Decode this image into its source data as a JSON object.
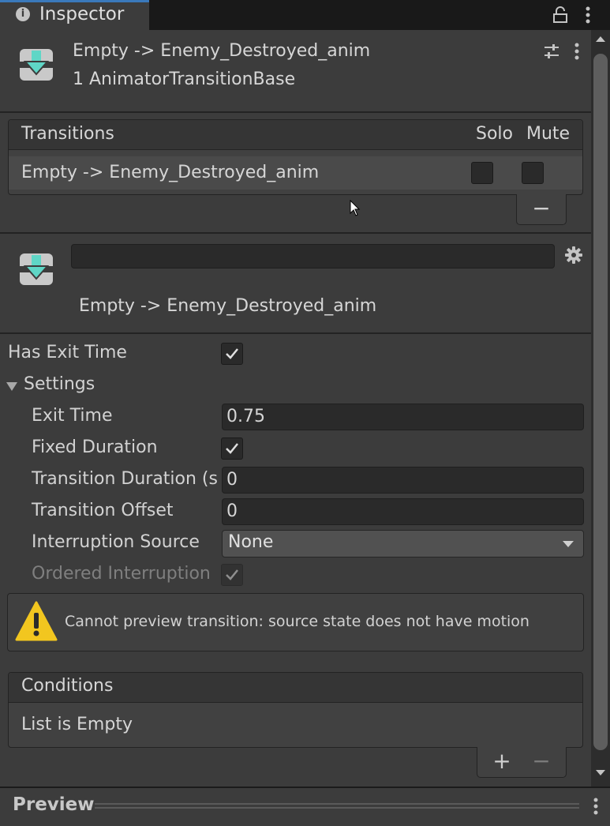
{
  "tab": {
    "title": "Inspector",
    "icon": "info-icon"
  },
  "header": {
    "title": "Empty -> Enemy_Destroyed_anim",
    "subtitle": "1 AnimatorTransitionBase"
  },
  "transitions": {
    "title": "Transitions",
    "solo_label": "Solo",
    "mute_label": "Mute",
    "rows": [
      {
        "label": "Empty -> Enemy_Destroyed_anim",
        "solo": false,
        "mute": false
      }
    ],
    "remove_label": "−"
  },
  "transition": {
    "name_value": "",
    "display_name": "Empty -> Enemy_Destroyed_anim"
  },
  "settings": {
    "has_exit_time_label": "Has Exit Time",
    "has_exit_time": true,
    "foldout_label": "Settings",
    "exit_time_label": "Exit Time",
    "exit_time_value": "0.75",
    "fixed_duration_label": "Fixed Duration",
    "fixed_duration": true,
    "transition_duration_label": "Transition Duration (s",
    "transition_duration_value": "0",
    "transition_offset_label": "Transition Offset",
    "transition_offset_value": "0",
    "interruption_source_label": "Interruption Source",
    "interruption_source_value": "None",
    "ordered_interruption_label": "Ordered Interruption",
    "ordered_interruption": true
  },
  "warning": {
    "text": "Cannot preview transition: source state does not have motion"
  },
  "conditions": {
    "title": "Conditions",
    "empty_text": "List is Empty",
    "add_label": "+",
    "remove_label": "−"
  },
  "preview": {
    "label": "Preview"
  },
  "colors": {
    "panel": "#3c3c3c",
    "field": "#2a2a2a",
    "accent": "#3a79bb",
    "icon_teal": "#5fd6c6",
    "warning": "#f2c61f"
  }
}
